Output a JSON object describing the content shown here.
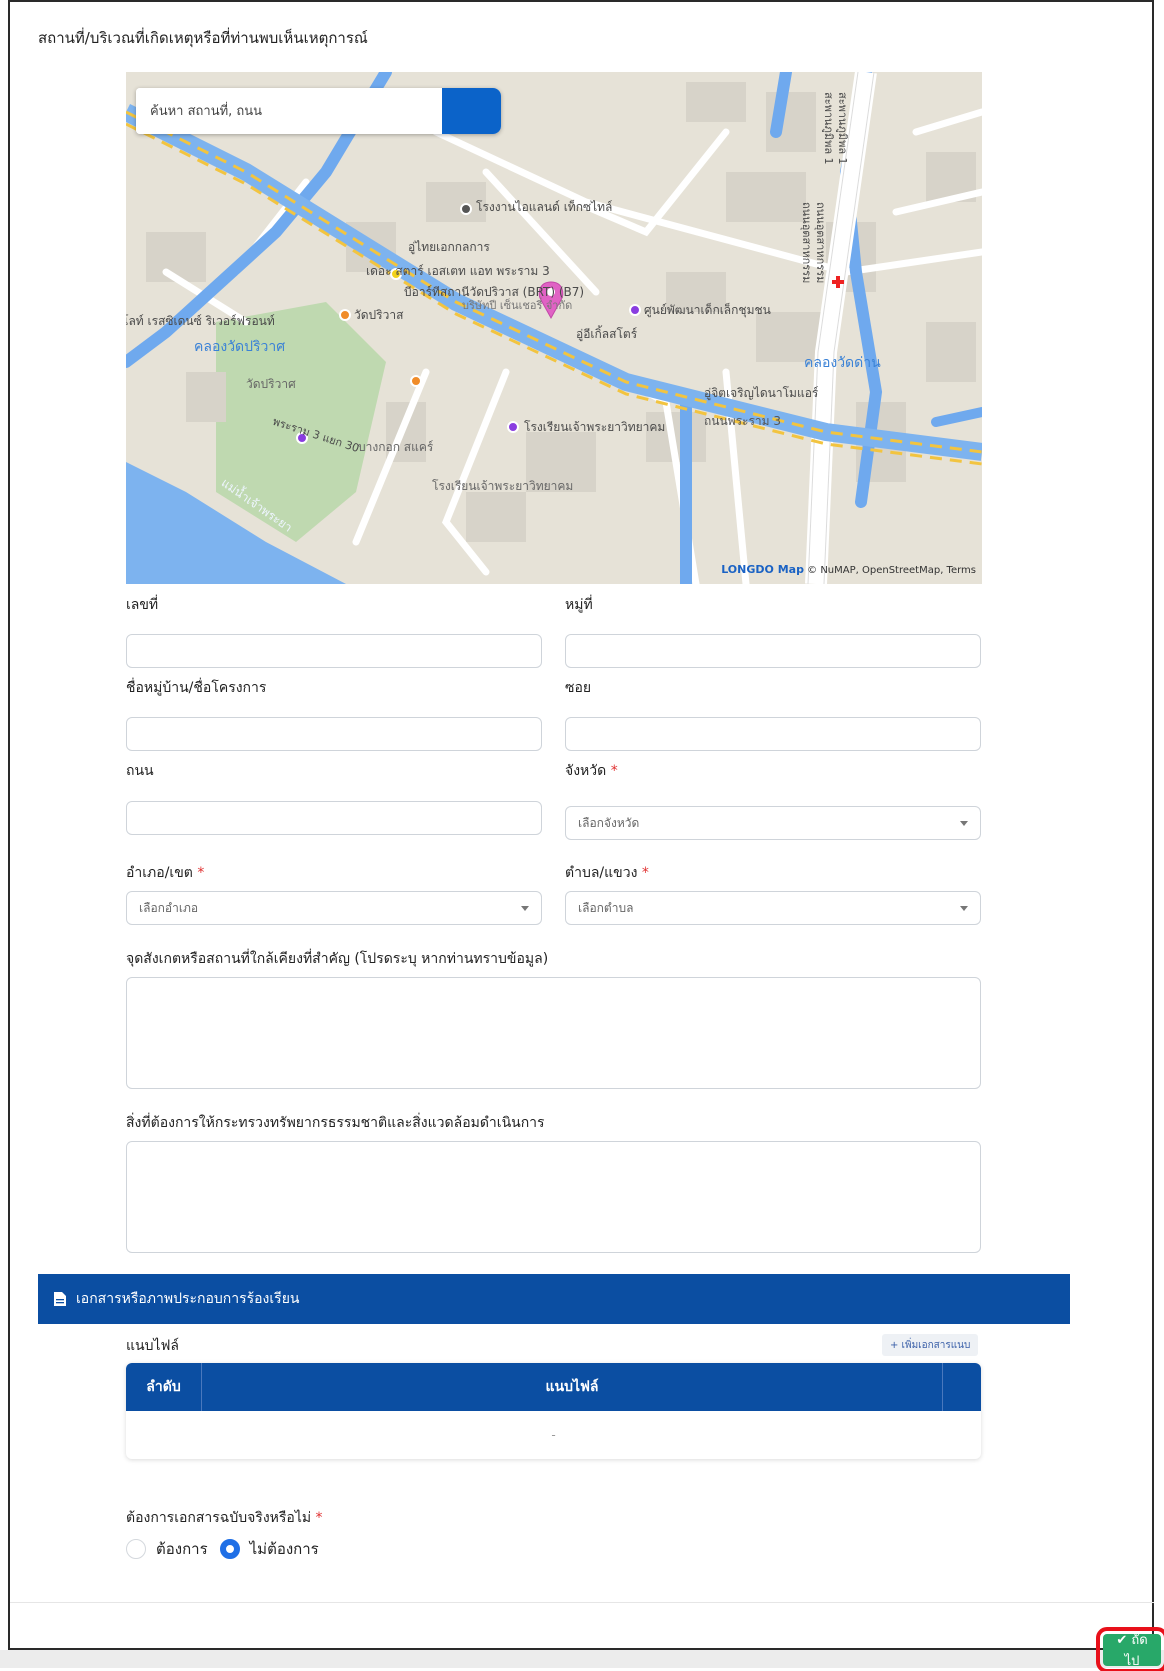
{
  "location_section": {
    "title": "สถานที่/บริเวณที่เกิดเหตุหรือที่ท่านพบเห็นเหตุการณ์"
  },
  "map": {
    "search_placeholder": "ค้นหา สถานที่, ถนน",
    "attribution_logo": "LONGDO Map",
    "attribution_text": "© NuMAP, OpenStreetMap, Terms",
    "labels": {
      "factory": "โรงงานไอแลนด์ เท็กซไทล์",
      "shipyard": "อู่ไทยเอกกลการ",
      "starestate": "เดอะ สตาร์ เอสเตท แอท พระราม 3",
      "brt": "บีอาร์ทีสถานีวัดปริวาส (BRT) (B7)",
      "company": "บริษัทปี เซ็นเชอรี่ จำกัด",
      "community": "ศูนย์พัฒนาเด็กเล็กชุมชน",
      "wat_pariwat": "วัดปริวาส",
      "wat_pariwat_area": "วัดปริวาศ",
      "garage": "อู่อีเกิ้ลสโตร์",
      "riverfront": "โลท์ เรสซิเดนซ์ ริเวอร์ฟรอนท์",
      "canal_pariwat": "คลองวัดปริวาศ",
      "canal_dan": "คลองวัดด่าน",
      "jaroen": "อู่จิตเจริญไดนาโมแอร์",
      "rama3_road": "ถนนพระราม 3",
      "soi30": "พระราม 3 แยก 30",
      "bangkok_sakae": "บางกอก สแคร์",
      "school": "โรงเรียนเจ้าพระยาวิทยาคม",
      "school2": "โรงเรียนเจ้าพระยาวิทยาคม",
      "river": "แม่น้ำเจ้าพระยา",
      "bhumibol": "สะพานภูมิพล 1",
      "bhumibol2": "สะพานภูมิพล 1",
      "khwaeng_road": "ถนนอุตสาหกรรม",
      "khwaeng_road2": "ถนนอุตสาหกรรม"
    }
  },
  "form": {
    "house_no": {
      "label": "เลขที่",
      "value": ""
    },
    "moo": {
      "label": "หมู่ที่",
      "value": ""
    },
    "village": {
      "label": "ชื่อหมู่บ้าน/ชื่อโครงการ",
      "value": ""
    },
    "soi": {
      "label": "ซอย",
      "value": ""
    },
    "road": {
      "label": "ถนน",
      "value": ""
    },
    "province": {
      "label": "จังหวัด",
      "required": "*",
      "placeholder": "เลือกจังหวัด"
    },
    "district": {
      "label": "อำเภอ/เขต",
      "required": "*",
      "placeholder": "เลือกอำเภอ"
    },
    "subdistrict": {
      "label": "ตำบล/แขวง",
      "required": "*",
      "placeholder": "เลือกตำบล"
    },
    "landmark": {
      "label": "จุดสังเกตหรือสถานที่ใกล้เคียงที่สำคัญ (โปรดระบุ หากท่านทราบข้อมูล)",
      "value": ""
    },
    "request": {
      "label": "สิ่งที่ต้องการให้กระทรวงทรัพยากรธรรมชาติและสิ่งแวดล้อมดำเนินการ",
      "value": ""
    }
  },
  "documents": {
    "header": "เอกสารหรือภาพประกอบการร้องเรียน",
    "attachment_label": "แนบไฟล์",
    "add_button": "+ เพิ่มเอกสารแนบ",
    "table": {
      "col_index": "ลำดับ",
      "col_file": "แนบไฟล์",
      "empty_row": "-"
    }
  },
  "original_doc": {
    "question": "ต้องการเอกสารฉบับจริงหรือไม่",
    "required": "*",
    "option_yes": "ต้องการ",
    "option_no": "ไม่ต้องการ",
    "selected": "ไม่ต้องการ"
  },
  "footer": {
    "next_button": "✔ ถัดไป"
  },
  "colors": {
    "primary_blue": "#0b4ea2",
    "search_button_blue": "#0b63c9",
    "next_green": "#28a869",
    "required_red": "#e03131",
    "highlight_red": "#e8101a"
  }
}
